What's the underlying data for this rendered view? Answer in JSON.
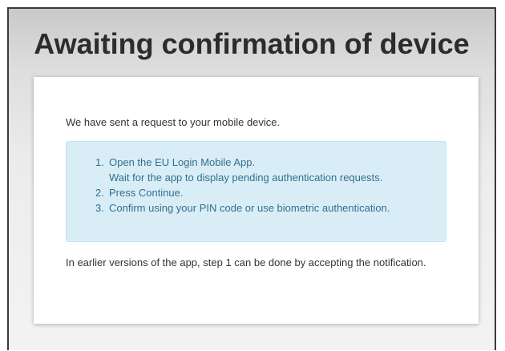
{
  "page": {
    "title": "Awaiting confirmation of device"
  },
  "card": {
    "intro": "We have sent a request to your mobile device.",
    "steps": [
      {
        "number": "1.",
        "line1": "Open the EU Login Mobile App.",
        "line2": "Wait for the app to display pending authentication requests."
      },
      {
        "number": "2.",
        "line1": "Press Continue."
      },
      {
        "number": "3.",
        "line1": "Confirm using your PIN code or use biometric authentication."
      }
    ],
    "note": "In earlier versions of the app, step 1 can be done by accepting the notification."
  },
  "colors": {
    "info_background": "#d9edf7",
    "info_border": "#bce8f1",
    "info_text": "#31708f",
    "body_text": "#333333"
  }
}
